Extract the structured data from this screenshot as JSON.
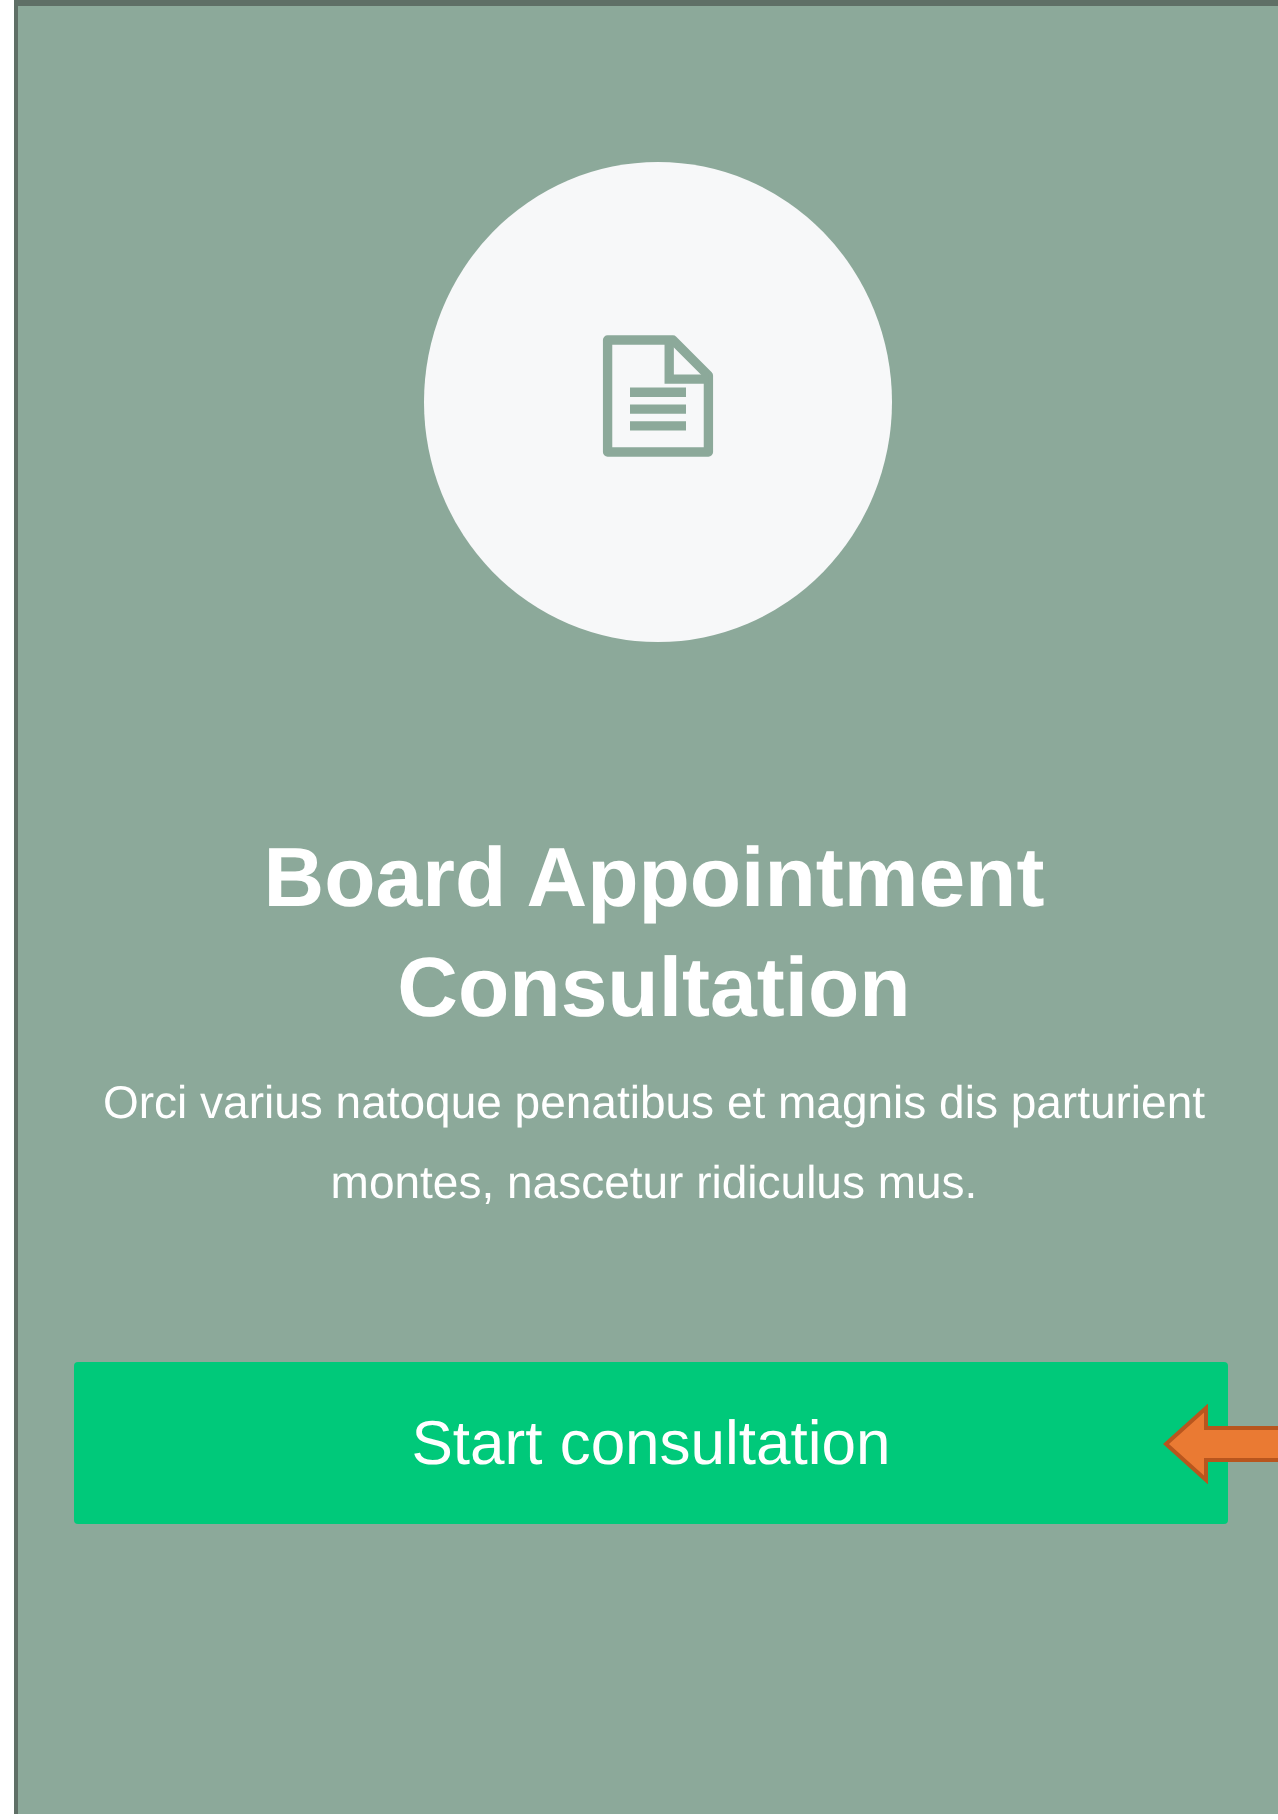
{
  "card": {
    "title": "Board Appointment Consultation",
    "description": "Orci varius natoque penatibus et magnis dis parturient montes, nascetur ridiculus mus.",
    "button": {
      "label": "Start consultation",
      "highlighted": true
    }
  }
}
